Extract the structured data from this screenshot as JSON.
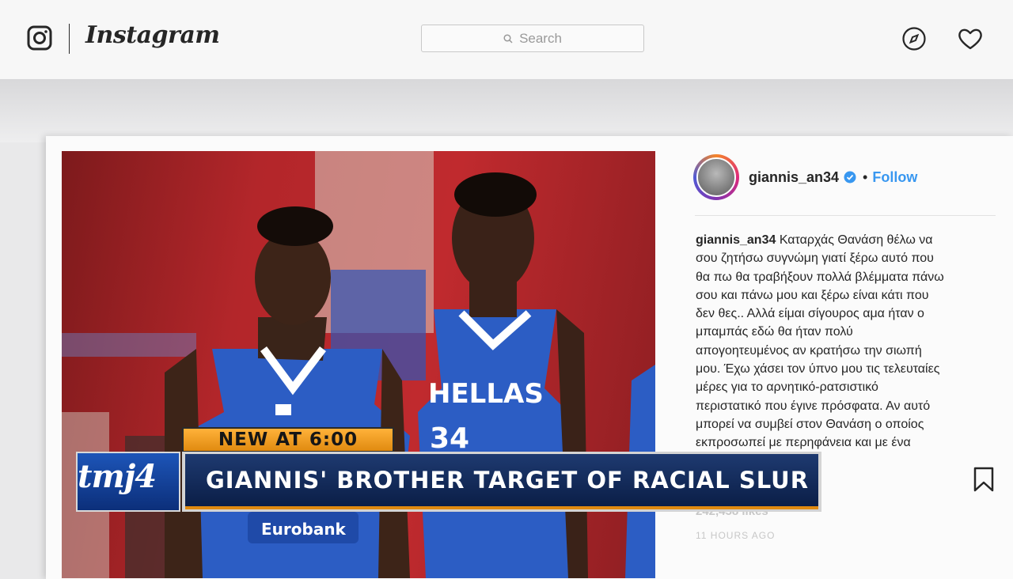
{
  "header": {
    "brand": "Instagram",
    "search_placeholder": "Search",
    "icons": [
      "instagram-logo-icon",
      "search-icon",
      "explore-compass-icon",
      "heart-icon"
    ]
  },
  "post": {
    "username": "giannis_an34",
    "separator": "•",
    "follow_label": "Follow",
    "caption_lines": [
      "Καταρχάς Θανάση θέλω να",
      "σου ζητήσω συγνώμη γιατί ξέρω αυτό που",
      "θα πω θα τραβήξουν πολλά βλέμματα πάνω",
      "σου και πάνω μου και ξέρω είναι κάτι που",
      "δεν θες.. Αλλά είμαι σίγουρος αμα ήταν ο",
      "μπαμπάς εδώ θα ήταν πολύ",
      "απογοητευμένος αν κρατήσω την σιωπή",
      "μου. Έχω χάσει τον ύπνο μου τις τελευταίες",
      "μέρες για το αρνητικό-ρατσιστικό",
      "περιστατικό που έγινε πρόσφατα. Αν αυτό",
      "μπορεί να συμβεί στον Θανάση ο οποίος",
      "εκπροσωπεί με περηφάνεια και με ένα"
    ],
    "likes": "242,458 likes",
    "time": "11 HOURS AGO",
    "photo": {
      "jersey_text": "HELLAS",
      "jersey_number": "34",
      "sponsor": "Eurobank"
    }
  },
  "broadcast": {
    "tag": "NEW AT 6:00",
    "station_logo": "tmj4",
    "headline": "GIANNIS' BROTHER TARGET OF RACIAL SLUR",
    "colors": {
      "tag": "#e08a10",
      "headline_bg": "#0b1e47"
    }
  }
}
